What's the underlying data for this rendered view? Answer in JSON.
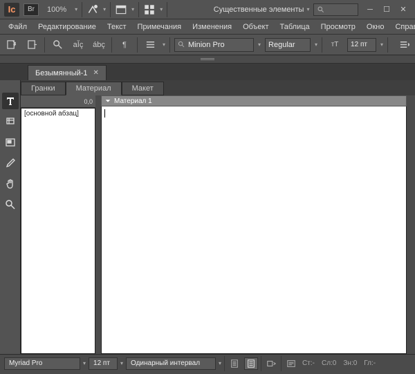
{
  "topbar": {
    "logo": "Ic",
    "bridge": "Br",
    "zoom": "100%",
    "essentials": "Существенные элементы"
  },
  "menubar": [
    "Файл",
    "Редактирование",
    "Текст",
    "Примечания",
    "Изменения",
    "Объект",
    "Таблица",
    "Просмотр",
    "Окно",
    "Справка"
  ],
  "toolbar": {
    "font": "Minion Pro",
    "style": "Regular",
    "size": "12 пт"
  },
  "doc": {
    "tab_title": "Безымянный-1"
  },
  "views": {
    "galley": "Гранки",
    "story": "Материал",
    "layout": "Макет"
  },
  "canvas": {
    "ruler_val": "0,0",
    "para_style": "[основной абзац]",
    "material_hdr": "Материал 1"
  },
  "status": {
    "font": "Myriad Pro",
    "size": "12 пт",
    "leading": "Одинарный интервал",
    "labels": {
      "st": "Ст:-",
      "sl": "Сл:0",
      "zn": "Зн:0",
      "gl": "Гл:-"
    }
  }
}
